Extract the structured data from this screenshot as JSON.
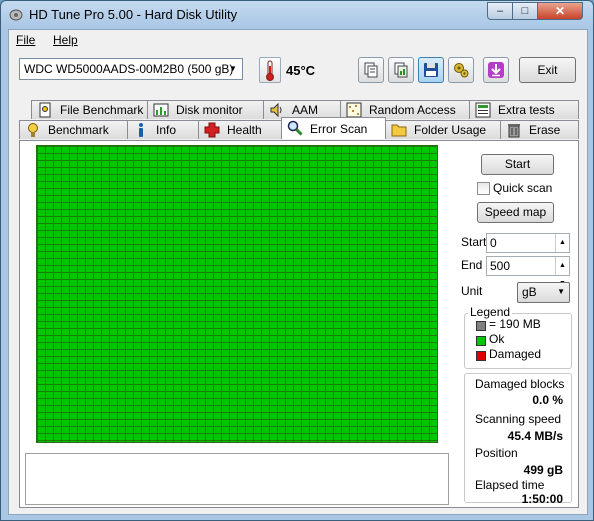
{
  "window": {
    "title": "HD Tune Pro 5.00 - Hard Disk Utility"
  },
  "controls": {
    "minimize": "–",
    "maximize": "□",
    "close": "✕"
  },
  "menu": {
    "file": "File",
    "help": "Help"
  },
  "toolbar": {
    "drive": "WDC WD5000AADS-00M2B0 (500 gB)",
    "temperature": "45°C",
    "exit_label": "Exit"
  },
  "tabs": {
    "top_row": [
      {
        "label": "File Benchmark",
        "icon": "file-benchmark-icon"
      },
      {
        "label": "Disk monitor",
        "icon": "disk-monitor-icon"
      },
      {
        "label": "AAM",
        "icon": "speaker-icon"
      },
      {
        "label": "Random Access",
        "icon": "random-access-icon"
      },
      {
        "label": "Extra tests",
        "icon": "extra-tests-icon"
      }
    ],
    "bottom_row": [
      {
        "label": "Benchmark",
        "icon": "benchmark-icon"
      },
      {
        "label": "Info",
        "icon": "info-icon"
      },
      {
        "label": "Health",
        "icon": "health-icon"
      },
      {
        "label": "Error Scan",
        "icon": "magnifier-icon"
      },
      {
        "label": "Folder Usage",
        "icon": "folder-icon"
      },
      {
        "label": "Erase",
        "icon": "trash-icon"
      }
    ],
    "selected": "Error Scan"
  },
  "scan": {
    "start_label": "Start",
    "quick_scan_label": "Quick scan",
    "quick_scan_checked": false,
    "speed_map_label": "Speed map",
    "start_field_label": "Start",
    "start_value": "0",
    "end_field_label": "End",
    "end_value": "500",
    "unit_label": "Unit",
    "unit_value": "gB",
    "block_status": "Ok"
  },
  "legend": {
    "title": "Legend",
    "items": [
      {
        "label": "= 190 MB",
        "color": "#808080"
      },
      {
        "label": "Ok",
        "color": "#00c800"
      },
      {
        "label": "Damaged",
        "color": "#e00000"
      }
    ]
  },
  "stats": {
    "damaged_label": "Damaged blocks",
    "damaged_value": "0.0 %",
    "speed_label": "Scanning speed",
    "speed_value": "45.4 MB/s",
    "position_label": "Position",
    "position_value": "499 gB",
    "elapsed_label": "Elapsed time",
    "elapsed_value": "1:50:00"
  }
}
